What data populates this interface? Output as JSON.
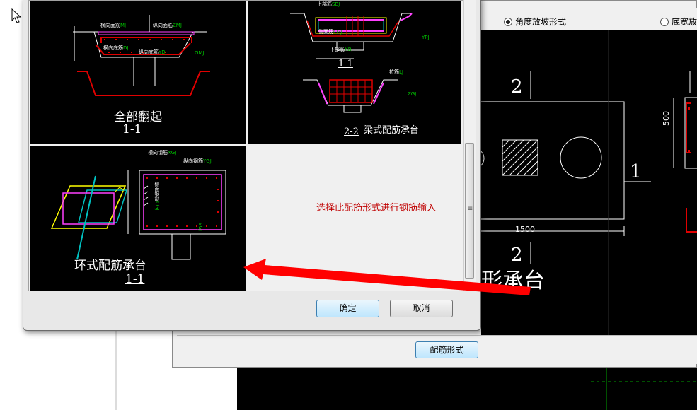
{
  "parent": {
    "radio_angle": "角度放坡形式",
    "radio_bottom": "底宽放",
    "button_reinforce": "配筋形式"
  },
  "cad": {
    "dim_500": "500",
    "dim_1500": "1500",
    "section_2_top": "2",
    "section_1_right": "1",
    "section_2_bottom": "2",
    "big_title": "形承台"
  },
  "dialog": {
    "hint": "选择此配筋形式进行钢筋输入",
    "ok": "确定",
    "cancel": "取消",
    "grip": "≡"
  },
  "thumbs": {
    "full": {
      "title": "全部翻起",
      "section": "1-1",
      "label_top": "横向面筋",
      "label_top_code": "MJ",
      "label_top2": "纵向面筋",
      "label_top2_code": "ZMJ",
      "label_bottom": "横向底筋",
      "label_bottom_code": "DJ",
      "label_bottom2": "纵向底筋",
      "label_bottom2_code": "YDJ",
      "label_side": "GMJ"
    },
    "beam": {
      "title": "梁式配筋承台",
      "section_a": "1-1",
      "section_b": "2-2",
      "label_top": "上部筋",
      "label_top_code": "SBJ",
      "label_side": "侧面筋",
      "label_side_code": "CGJ",
      "label_bot": "下部筋",
      "label_bot_code": "XBJ",
      "label_lj": "拉筋",
      "label_lj_code": "LJ",
      "label_ypj": "YPJ",
      "label_gj": "ZGJ"
    },
    "ring": {
      "title": "环式配筋承台",
      "section": "1-1",
      "label_h": "横向钢筋",
      "label_h_code": "XGJ",
      "label_v": "纵向钢筋",
      "label_v_code": "YGJ",
      "label_side": "侧面钢筋",
      "label_side_code": "CGJ",
      "label_gj": "SGJ"
    }
  },
  "colors": {
    "cad_bg": "#000000",
    "red_line": "#e00000",
    "magenta": "#ff40ff",
    "green_text": "#00c000",
    "yellow": "#ffff00",
    "cyan": "#00c0c0",
    "hint_red": "#c00000",
    "arrow_red": "#ff0000"
  }
}
